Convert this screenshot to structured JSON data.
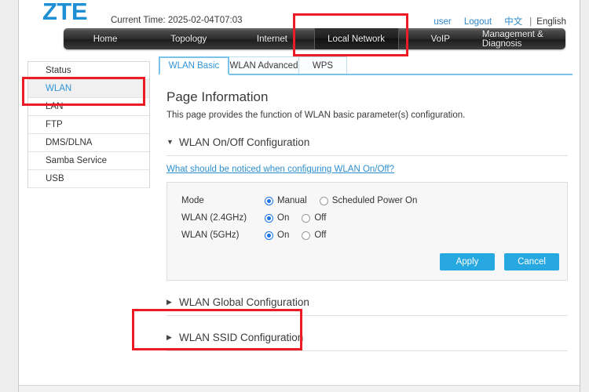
{
  "header": {
    "logo": "ZTE",
    "current_time_label": "Current Time: 2025-02-04T07:03",
    "user_link": "user",
    "logout_link": "Logout",
    "lang_zh": "中文",
    "lang_separator": "|",
    "lang_en": "English"
  },
  "nav": {
    "items": [
      {
        "label": "Home",
        "active": false
      },
      {
        "label": "Topology",
        "active": false
      },
      {
        "label": "Internet",
        "active": false
      },
      {
        "label": "Local Network",
        "active": true
      },
      {
        "label": "VoIP",
        "active": false
      },
      {
        "label": "Management & Diagnosis",
        "active": false
      }
    ]
  },
  "sidebar": {
    "items": [
      {
        "label": "Status",
        "active": false
      },
      {
        "label": "WLAN",
        "active": true
      },
      {
        "label": "LAN",
        "active": false
      },
      {
        "label": "FTP",
        "active": false
      },
      {
        "label": "DMS/DLNA",
        "active": false
      },
      {
        "label": "Samba Service",
        "active": false
      },
      {
        "label": "USB",
        "active": false
      }
    ]
  },
  "tabs": [
    {
      "label": "WLAN Basic",
      "active": true
    },
    {
      "label": "WLAN Advanced",
      "active": false
    },
    {
      "label": "WPS",
      "active": false
    }
  ],
  "page": {
    "title": "Page Information",
    "description": "This page provides the function of WLAN basic parameter(s) configuration."
  },
  "sections": {
    "onoff": {
      "title": "WLAN On/Off Configuration",
      "expanded": true,
      "arrow_glyph": "▼",
      "notice_link": "What should be noticed when configuring WLAN On/Off?",
      "rows": [
        {
          "label": "Mode",
          "options": [
            {
              "label": "Manual",
              "checked": true
            },
            {
              "label": "Scheduled Power On",
              "checked": false
            }
          ]
        },
        {
          "label": "WLAN (2.4GHz)",
          "options": [
            {
              "label": "On",
              "checked": true
            },
            {
              "label": "Off",
              "checked": false
            }
          ]
        },
        {
          "label": "WLAN (5GHz)",
          "options": [
            {
              "label": "On",
              "checked": true
            },
            {
              "label": "Off",
              "checked": false
            }
          ]
        }
      ],
      "apply_label": "Apply",
      "cancel_label": "Cancel"
    },
    "global": {
      "title": "WLAN Global Configuration",
      "expanded": false,
      "arrow_glyph": "▶"
    },
    "ssid": {
      "title": "WLAN SSID Configuration",
      "expanded": false,
      "arrow_glyph": "▶"
    }
  },
  "colors": {
    "brand_blue": "#1d8fd4",
    "accent_blue": "#28a8e0",
    "tab_active": "#2d94d6",
    "radio_checked": "#1a73e8",
    "annotation_red": "#ee1b24"
  }
}
